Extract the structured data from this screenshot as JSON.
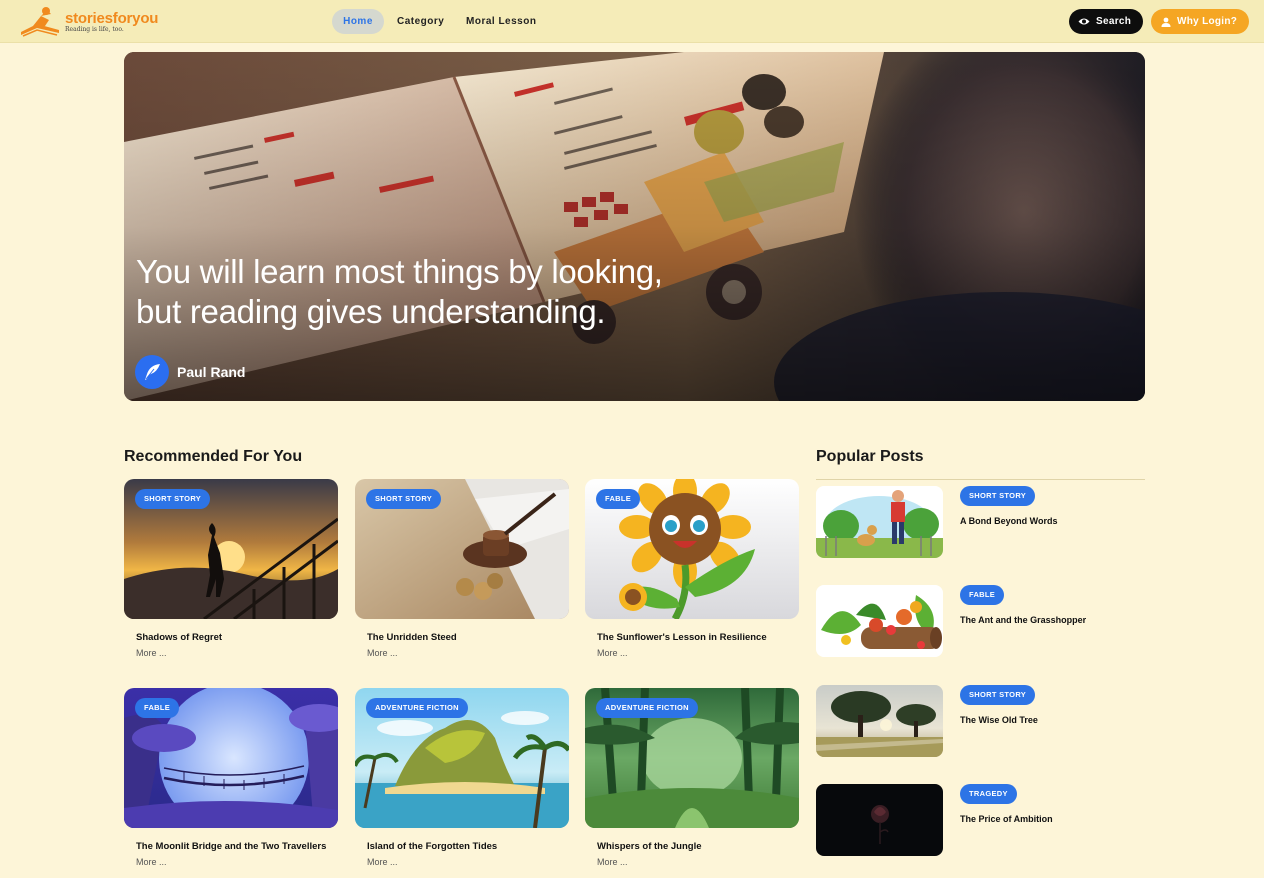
{
  "brand": {
    "name": "storiesforyou",
    "tagline": "Reading is life, too.",
    "logo_icon": "reader-on-book-icon",
    "accent_color": "#f08a1e"
  },
  "nav": {
    "links": [
      {
        "label": "Home",
        "active": true
      },
      {
        "label": "Category",
        "active": false
      },
      {
        "label": "Moral Lesson",
        "active": false
      }
    ],
    "search_label": "Search",
    "login_label": "Why Login?"
  },
  "hero": {
    "quote_line1": "You will learn most things by looking,",
    "quote_line2": "but reading gives understanding.",
    "author": "Paul Rand",
    "author_icon": "feather-icon"
  },
  "recommended": {
    "title": "Recommended For You",
    "more_label": "More ...",
    "items": [
      {
        "category": "SHORT STORY",
        "title": "Shadows of Regret"
      },
      {
        "category": "SHORT STORY",
        "title": "The Unridden Steed"
      },
      {
        "category": "FABLE",
        "title": "The Sunflower's Lesson in Resilience"
      },
      {
        "category": "FABLE",
        "title": "The Moonlit Bridge and the Two Travellers"
      },
      {
        "category": "ADVENTURE FICTION",
        "title": "Island of the Forgotten Tides"
      },
      {
        "category": "ADVENTURE FICTION",
        "title": "Whispers of the Jungle"
      }
    ]
  },
  "popular": {
    "title": "Popular Posts",
    "items": [
      {
        "category": "SHORT STORY",
        "title": "A Bond Beyond Words"
      },
      {
        "category": "FABLE",
        "title": "The Ant and the Grasshopper"
      },
      {
        "category": "SHORT STORY",
        "title": "The Wise Old Tree"
      },
      {
        "category": "TRAGEDY",
        "title": "The Price of Ambition"
      }
    ]
  },
  "colors": {
    "badge": "#2d74e6",
    "search_button": "#0d0d0d",
    "login_button": "#f5a623",
    "page_bg": "#fdf5d8"
  }
}
